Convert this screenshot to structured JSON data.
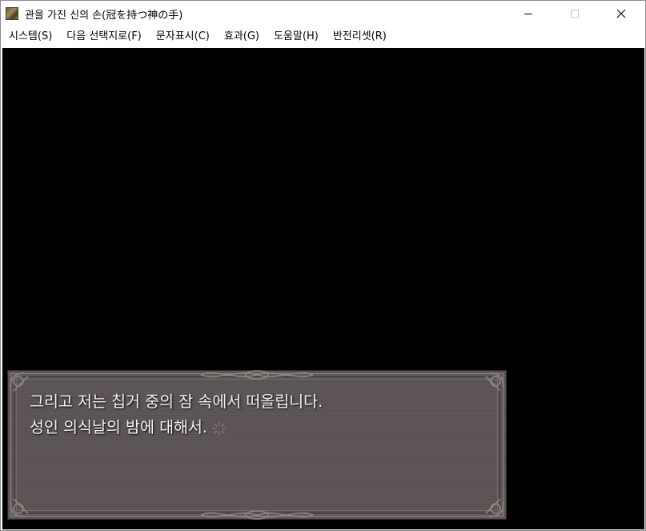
{
  "window": {
    "title": "관을 가진 신의 손(冠を持つ神の手)",
    "icon": "app-icon"
  },
  "controls": {
    "minimize_icon": "minimize-icon",
    "maximize_icon": "maximize-icon",
    "close_icon": "close-icon"
  },
  "menu": {
    "items": [
      {
        "label": "시스템(S)"
      },
      {
        "label": "다음 선택지로(F)"
      },
      {
        "label": "문자표시(C)"
      },
      {
        "label": "효과(G)"
      },
      {
        "label": "도움말(H)"
      },
      {
        "label": "반전리셋(R)"
      }
    ]
  },
  "game": {
    "background_color": "#000000",
    "message": {
      "lines": [
        "그리고 저는 칩거 중의 잠 속에서 떠올립니다.",
        "성인 의식날의 밤에 대해서."
      ],
      "wait_icon": "sparkle-wait-icon"
    }
  },
  "colors": {
    "frame_fill": "#5e5656",
    "frame_border": "#2a2222",
    "text": "#f4f4f4"
  }
}
